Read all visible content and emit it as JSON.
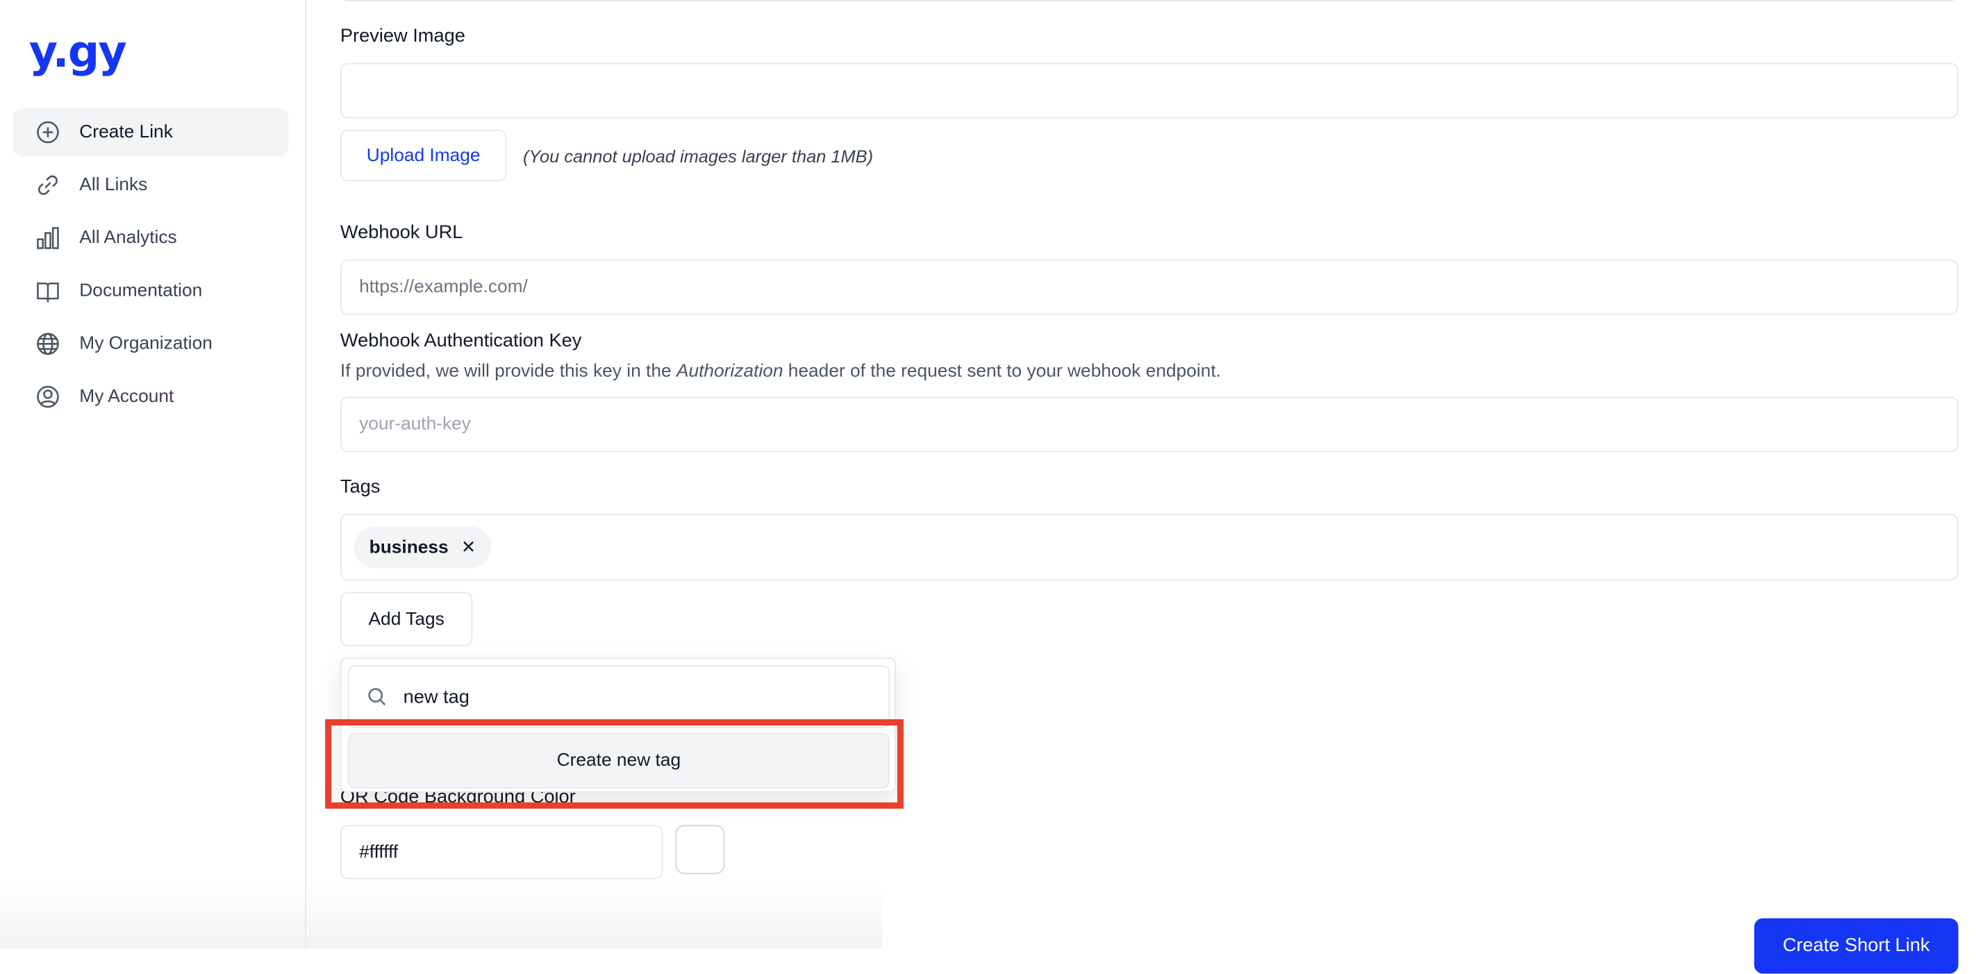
{
  "brand": {
    "logo": "y.gy",
    "color": "#1636f5"
  },
  "sidebar": {
    "items": [
      {
        "label": "Create Link",
        "icon": "plus-circle-icon",
        "active": true
      },
      {
        "label": "All Links",
        "icon": "link-icon"
      },
      {
        "label": "All Analytics",
        "icon": "bar-chart-icon"
      },
      {
        "label": "Documentation",
        "icon": "book-icon"
      },
      {
        "label": "My Organization",
        "icon": "globe-icon"
      },
      {
        "label": "My Account",
        "icon": "user-circle-icon"
      }
    ]
  },
  "form": {
    "preview_image": {
      "label": "Preview Image",
      "value": "",
      "upload_label": "Upload Image",
      "note": "(You cannot upload images larger than 1MB)"
    },
    "webhook_url": {
      "label": "Webhook URL",
      "value": "https://example.com/"
    },
    "webhook_key": {
      "label": "Webhook Authentication Key",
      "desc_pre": "If provided, we will provide this key in the ",
      "desc_em": "Authorization",
      "desc_post": " header of the request sent to your webhook endpoint.",
      "placeholder": "your-auth-key"
    },
    "tags": {
      "label": "Tags",
      "items": [
        "business"
      ],
      "add_label": "Add Tags"
    },
    "tag_dropdown": {
      "search_value": "new tag",
      "create_label": "Create new tag"
    },
    "qr_bg": {
      "label": "QR Code Background Color",
      "value": "#ffffff"
    },
    "submit_label": "Create Short Link"
  },
  "highlight_color": "#e8402a"
}
